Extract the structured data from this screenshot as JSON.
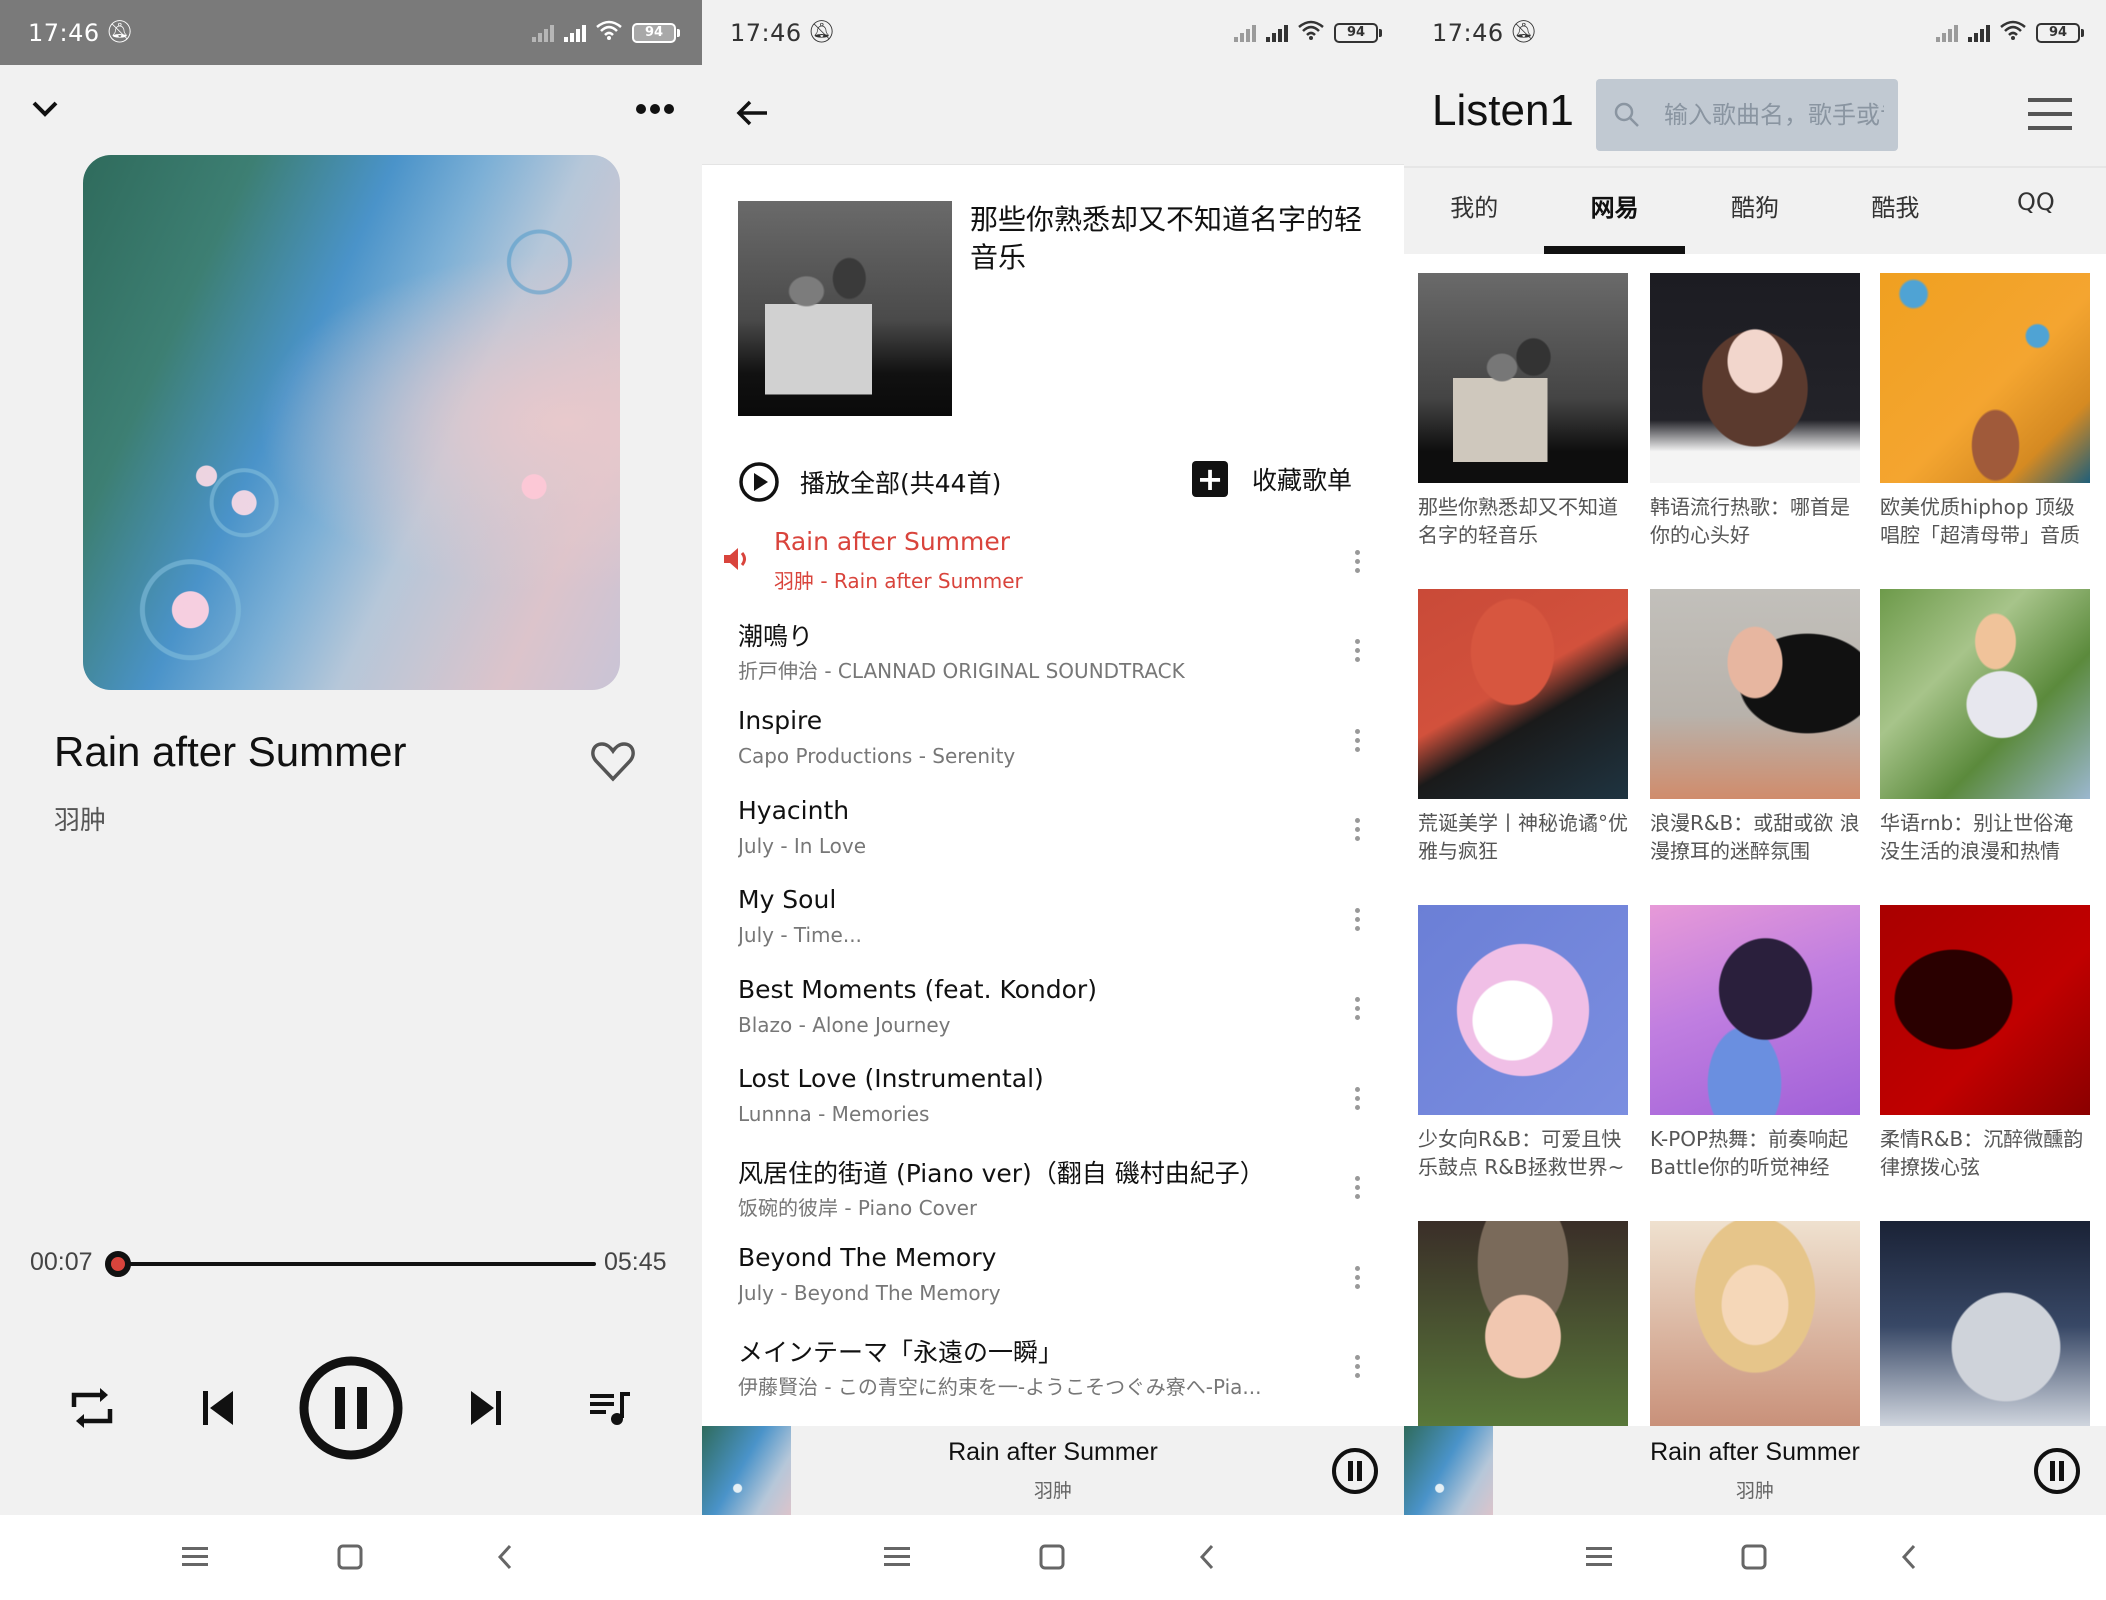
{
  "status_bar": {
    "time": "17:46",
    "battery": "94"
  },
  "now_playing": {
    "title": "Rain after Summer",
    "artist": "羽肿",
    "current_time": "00:07",
    "total_time": "05:45",
    "progress_fraction": 0.02,
    "accent_color": "#d9443c",
    "icons": {
      "collapse": "chevron-down-icon",
      "more": "more-horizontal-icon",
      "favorite": "heart-outline-icon",
      "repeat": "repeat-icon",
      "previous": "skip-previous-icon",
      "play_pause": "pause-circle-icon",
      "next": "skip-next-icon",
      "queue": "queue-music-icon"
    }
  },
  "playlist": {
    "title": "那些你熟悉却又不知道名字的轻音乐",
    "play_all_label": "播放全部(共44首)",
    "collect_label": "收藏歌单",
    "tracks": [
      {
        "title": "Rain after Summer",
        "subtitle": "羽肿 - Rain after Summer",
        "playing": true
      },
      {
        "title": "潮鳴り",
        "subtitle": "折戸伸治 - CLANNAD ORIGINAL SOUNDTRACK",
        "playing": false
      },
      {
        "title": "Inspire",
        "subtitle": "Capo Productions - Serenity",
        "playing": false
      },
      {
        "title": "Hyacinth",
        "subtitle": "July - In Love",
        "playing": false
      },
      {
        "title": "My Soul",
        "subtitle": "July - Time...",
        "playing": false
      },
      {
        "title": "Best Moments (feat. Kondor)",
        "subtitle": "Blazo - Alone Journey",
        "playing": false
      },
      {
        "title": "Lost Love (Instrumental)",
        "subtitle": "Lunnna - Memories",
        "playing": false
      },
      {
        "title": "风居住的街道 (Piano ver)（翻自 磯村由紀子）",
        "subtitle": "饭碗的彼岸 - Piano Cover",
        "playing": false
      },
      {
        "title": "Beyond The Memory",
        "subtitle": "July - Beyond The Memory",
        "playing": false
      },
      {
        "title": "メインテーマ「永遠の一瞬」",
        "subtitle": "伊藤賢治 - この青空に約束を一-ようこそつぐみ寮へ-Pia...",
        "playing": false
      }
    ]
  },
  "mini_player": {
    "title": "Rain after Summer",
    "artist": "羽肿"
  },
  "home": {
    "brand": "Listen1",
    "search_placeholder": "输入歌曲名，歌手或专辑",
    "tabs": [
      {
        "label": "我的",
        "active": false
      },
      {
        "label": "网易",
        "active": true
      },
      {
        "label": "酷狗",
        "active": false
      },
      {
        "label": "酷我",
        "active": false
      },
      {
        "label": "QQ",
        "active": false
      }
    ],
    "playlists": [
      {
        "caption": "那些你熟悉却又不知道名字的轻音乐"
      },
      {
        "caption": "韩语流行热歌：哪首是你的心头好"
      },
      {
        "caption": "欧美优质hiphop 顶级唱腔「超清母带」音质"
      },
      {
        "caption": "荒诞美学丨神秘诡谲°优雅与疯狂"
      },
      {
        "caption": "浪漫R&B：或甜或欲 浪漫撩耳的迷醉氛围"
      },
      {
        "caption": "华语rnb：别让世俗淹没生活的浪漫和热情"
      },
      {
        "caption": "少女向R&B：可爱且快乐鼓点 R&B拯救世界~"
      },
      {
        "caption": "K-POP热舞：前奏响起 Battle你的听觉神经"
      },
      {
        "caption": "柔情R&B：沉醉微醺韵律撩拨心弦"
      },
      {
        "caption": ""
      },
      {
        "caption": ""
      },
      {
        "caption": ""
      }
    ]
  }
}
